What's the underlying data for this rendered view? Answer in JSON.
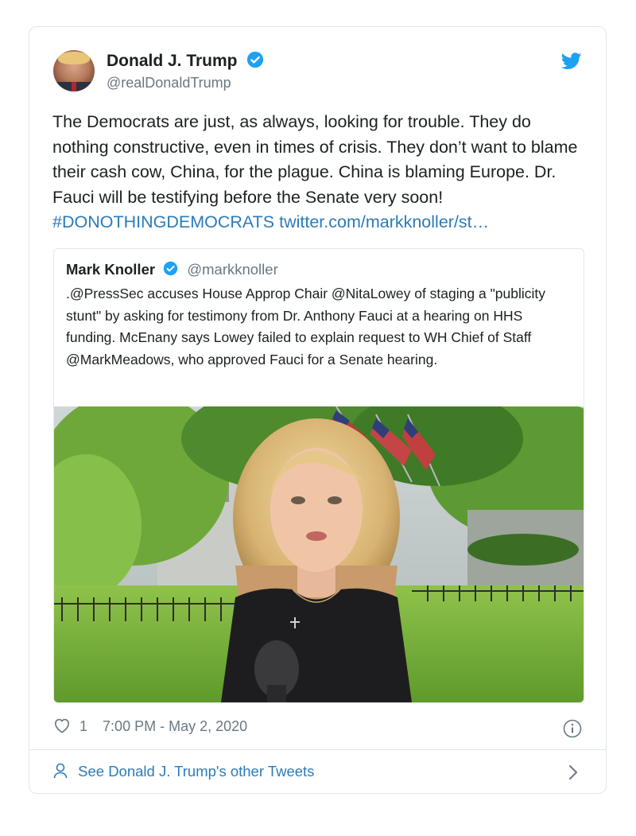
{
  "author": {
    "name": "Donald J. Trump",
    "handle": "@realDonaldTrump"
  },
  "tweet": {
    "text": "The Democrats are just, as always, looking for trouble. They do nothing constructive, even in times of crisis. They don’t want to blame their cash cow, China, for the plague. China is blaming Europe. Dr. Fauci will be testifying before the Senate very soon!",
    "hashtag": "#DONOTHINGDEMOCRATS",
    "link": "twitter.com/markknoller/st…"
  },
  "quoted": {
    "name": "Mark Knoller",
    "handle": "@markknoller",
    "text": ".@PressSec accuses House Approp Chair @NitaLowey of staging a \"publicity stunt\" by asking for testimony from Dr. Anthony Fauci at a hearing on HHS funding. McEnany says Lowey failed to explain request to WH Chief of Staff @MarkMeadows, who approved Fauci for a Senate hearing."
  },
  "footer": {
    "likes": "1",
    "timestamp": "7:00 PM - May 2, 2020",
    "see_others": "See Donald J. Trump's other Tweets"
  },
  "icons": {
    "verified": "verified-badge-icon",
    "bird": "twitter-bird-icon",
    "heart": "heart-icon",
    "info": "info-icon",
    "person": "person-icon",
    "chevron": "chevron-right-icon"
  },
  "colors": {
    "link": "#2b7bb9",
    "verified": "#1da1f2",
    "muted": "#697882",
    "border": "#e1e8ed"
  }
}
